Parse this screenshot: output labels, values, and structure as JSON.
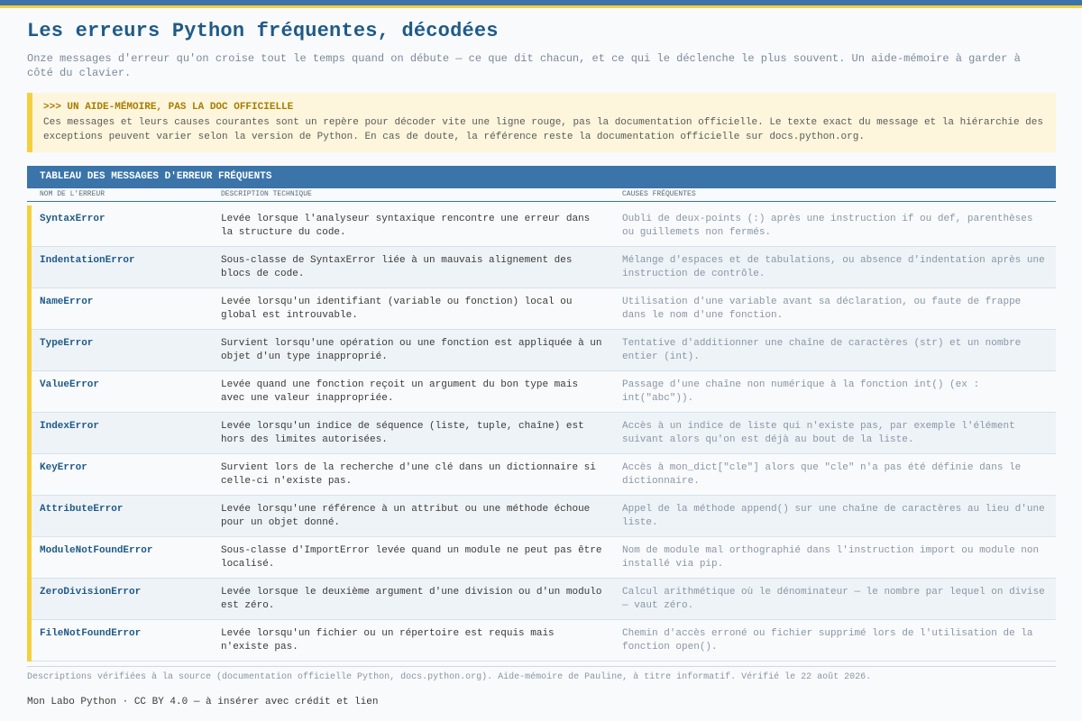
{
  "page": {
    "title": "Les erreurs Python fréquentes, décodées",
    "subtitle": "Onze messages d'erreur qu'on croise tout le temps quand on débute — ce que dit chacun, et ce qui le déclenche le plus souvent. Un aide-mémoire à garder à côté du clavier."
  },
  "callout": {
    "title": ">>> UN AIDE-MÉMOIRE, PAS LA DOC OFFICIELLE",
    "body": "Ces messages et leurs causes courantes sont un repère pour décoder vite une ligne rouge, pas la documentation officielle. Le texte exact du message et la hiérarchie des exceptions peuvent varier selon la version de Python. En cas de doute, la référence reste la documentation officielle sur docs.python.org."
  },
  "table": {
    "title": "TABLEAU DES MESSAGES D'ERREUR FRÉQUENTS",
    "columns": [
      "NOM DE L'ERREUR",
      "DESCRIPTION TECHNIQUE",
      "CAUSES FRÉQUENTES"
    ],
    "rows": [
      {
        "name": "SyntaxError",
        "description": "Levée lorsque l'analyseur syntaxique rencontre une erreur dans la structure du code.",
        "causes": "Oubli de deux-points (:) après une instruction if ou def, parenthèses ou guillemets non fermés."
      },
      {
        "name": "IndentationError",
        "description": "Sous-classe de SyntaxError liée à un mauvais alignement des blocs de code.",
        "causes": "Mélange d'espaces et de tabulations, ou absence d'indentation après une instruction de contrôle."
      },
      {
        "name": "NameError",
        "description": "Levée lorsqu'un identifiant (variable ou fonction) local ou global est introuvable.",
        "causes": "Utilisation d'une variable avant sa déclaration, ou faute de frappe dans le nom d'une fonction."
      },
      {
        "name": "TypeError",
        "description": "Survient lorsqu'une opération ou une fonction est appliquée à un objet d'un type inapproprié.",
        "causes": "Tentative d'additionner une chaîne de caractères (str) et un nombre entier (int)."
      },
      {
        "name": "ValueError",
        "description": "Levée quand une fonction reçoit un argument du bon type mais avec une valeur inappropriée.",
        "causes": "Passage d'une chaîne non numérique à la fonction int() (ex : int(\"abc\"))."
      },
      {
        "name": "IndexError",
        "description": "Levée lorsqu'un indice de séquence (liste, tuple, chaîne) est hors des limites autorisées.",
        "causes": "Accès à un indice de liste qui n'existe pas, par exemple l'élément suivant alors qu'on est déjà au bout de la liste."
      },
      {
        "name": "KeyError",
        "description": "Survient lors de la recherche d'une clé dans un dictionnaire si celle-ci n'existe pas.",
        "causes": "Accès à mon_dict[\"cle\"] alors que \"cle\" n'a pas été définie dans le dictionnaire."
      },
      {
        "name": "AttributeError",
        "description": "Levée lorsqu'une référence à un attribut ou une méthode échoue pour un objet donné.",
        "causes": "Appel de la méthode append() sur une chaîne de caractères au lieu d'une liste."
      },
      {
        "name": "ModuleNotFoundError",
        "description": "Sous-classe d'ImportError levée quand un module ne peut pas être localisé.",
        "causes": "Nom de module mal orthographié dans l'instruction import ou module non installé via pip."
      },
      {
        "name": "ZeroDivisionError",
        "description": "Levée lorsque le deuxième argument d'une division ou d'un modulo est zéro.",
        "causes": "Calcul arithmétique où le dénominateur — le nombre par lequel on divise — vaut zéro."
      },
      {
        "name": "FileNotFoundError",
        "description": "Levée lorsqu'un fichier ou un répertoire est requis mais n'existe pas.",
        "causes": "Chemin d'accès erroné ou fichier supprimé lors de l'utilisation de la fonction open()."
      }
    ]
  },
  "footer": {
    "note": "Descriptions vérifiées à la source (documentation officielle Python, docs.python.org). Aide-mémoire de Pauline, à titre informatif. Vérifié le 22 août 2026.",
    "credit": "Mon Labo Python · CC BY 4.0 — à insérer avec crédit et lien"
  },
  "colors": {
    "accent_blue": "#3a74a8",
    "accent_yellow": "#f4d03f",
    "title_blue": "#1f5a87"
  }
}
